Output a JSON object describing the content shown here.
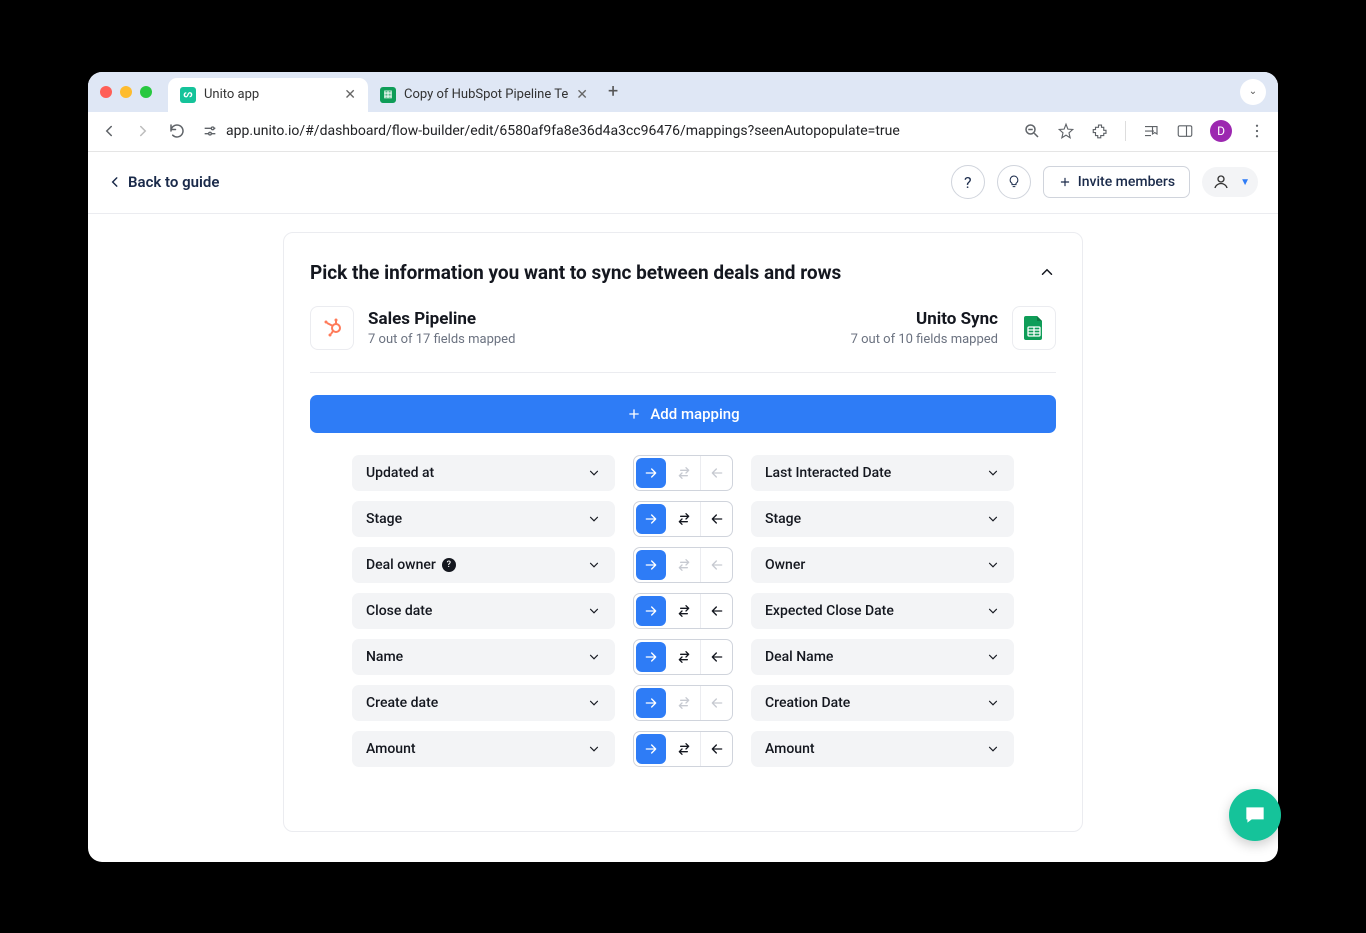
{
  "browser": {
    "tabs": [
      {
        "title": "Unito app",
        "favicon": "unito"
      },
      {
        "title": "Copy of HubSpot Pipeline Te",
        "favicon": "sheets"
      }
    ],
    "url": "app.unito.io/#/dashboard/flow-builder/edit/6580af9fa8e36d4a3cc96476/mappings?seenAutopopulate=true",
    "avatar": "D"
  },
  "appbar": {
    "back": "Back to guide",
    "invite": "Invite members"
  },
  "card": {
    "title": "Pick the information you want to sync between deals and rows",
    "left": {
      "name": "Sales Pipeline",
      "sub": "7 out of 17 fields mapped"
    },
    "right": {
      "name": "Unito Sync",
      "sub": "7 out of 10 fields mapped"
    },
    "add_label": "Add mapping"
  },
  "mappings": [
    {
      "left": "Updated at",
      "right": "Last Interacted Date",
      "dir": "right",
      "bidi_disabled": true,
      "info": false
    },
    {
      "left": "Stage",
      "right": "Stage",
      "dir": "right",
      "bidi_disabled": false,
      "info": false
    },
    {
      "left": "Deal owner",
      "right": "Owner",
      "dir": "right",
      "bidi_disabled": true,
      "info": true
    },
    {
      "left": "Close date",
      "right": "Expected Close Date",
      "dir": "right",
      "bidi_disabled": false,
      "info": false
    },
    {
      "left": "Name",
      "right": "Deal Name",
      "dir": "right",
      "bidi_disabled": false,
      "info": false
    },
    {
      "left": "Create date",
      "right": "Creation Date",
      "dir": "right",
      "bidi_disabled": true,
      "info": false
    },
    {
      "left": "Amount",
      "right": "Amount",
      "dir": "right",
      "bidi_disabled": false,
      "info": false
    }
  ]
}
